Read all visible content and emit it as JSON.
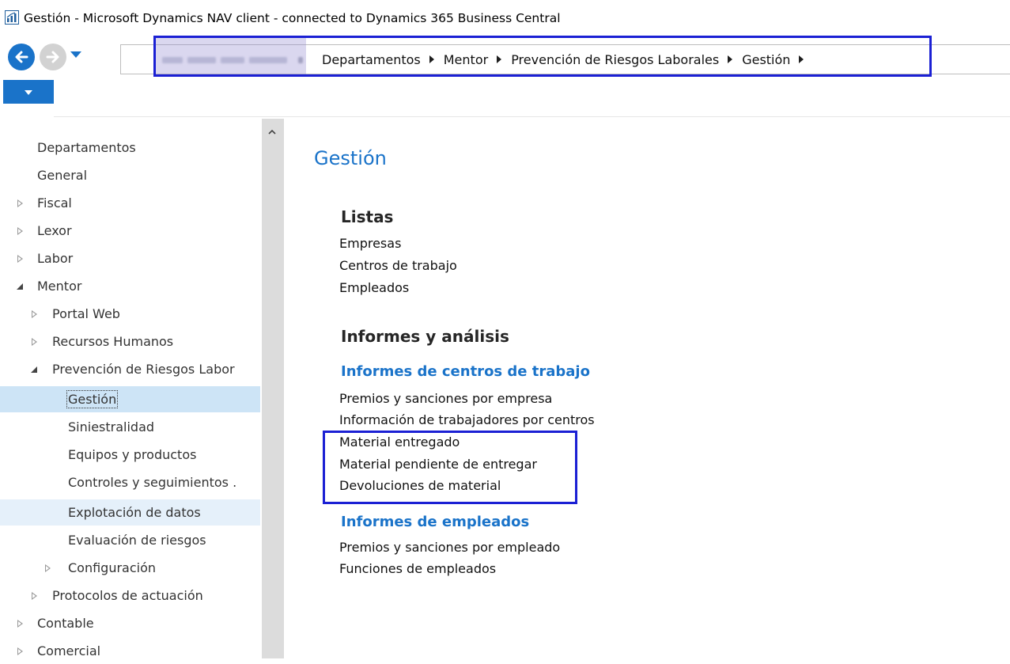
{
  "window": {
    "title": "Gestión - Microsoft Dynamics NAV client - connected to Dynamics 365 Business Central"
  },
  "nav": {
    "back_icon": "arrow-left-icon",
    "forward_icon": "arrow-right-icon",
    "history_icon": "chevron-down-icon"
  },
  "breadcrumb": {
    "items": [
      "Departamentos",
      "Mentor",
      "Prevención de Riesgos Laborales",
      "Gestión"
    ]
  },
  "sidebar": {
    "items": [
      {
        "label": "Departamentos",
        "expander": "none"
      },
      {
        "label": "General",
        "expander": "none"
      },
      {
        "label": "Fiscal",
        "expander": "collapsed"
      },
      {
        "label": "Lexor",
        "expander": "collapsed"
      },
      {
        "label": "Labor",
        "expander": "collapsed"
      },
      {
        "label": "Mentor",
        "expander": "expanded"
      },
      {
        "label": "Portal Web",
        "expander": "collapsed"
      },
      {
        "label": "Recursos Humanos",
        "expander": "collapsed"
      },
      {
        "label": "Prevención de Riesgos Labor",
        "expander": "expanded"
      },
      {
        "label": "Gestión",
        "expander": "none",
        "state": "selected"
      },
      {
        "label": "Siniestralidad",
        "expander": "none"
      },
      {
        "label": "Equipos y productos",
        "expander": "none"
      },
      {
        "label": "Controles y seguimientos .",
        "expander": "none"
      },
      {
        "label": "Explotación de datos",
        "expander": "none",
        "state": "hover"
      },
      {
        "label": "Evaluación de riesgos",
        "expander": "none"
      },
      {
        "label": "Configuración",
        "expander": "collapsed"
      },
      {
        "label": "Protocolos de actuación",
        "expander": "collapsed"
      },
      {
        "label": "Contable",
        "expander": "collapsed"
      },
      {
        "label": "Comercial",
        "expander": "collapsed"
      }
    ]
  },
  "content": {
    "page_title": "Gestión",
    "listas": {
      "heading": "Listas",
      "links": [
        "Empresas",
        "Centros de trabajo",
        "Empleados"
      ]
    },
    "informes": {
      "heading": "Informes y análisis",
      "groups": [
        {
          "title": "Informes de centros de trabajo",
          "links": [
            "Premios y sanciones por empresa",
            "Información de trabajadores por centros",
            "Material entregado",
            "Material pendiente de entregar",
            "Devoluciones de material"
          ]
        },
        {
          "title": "Informes de empleados",
          "links": [
            "Premios y sanciones por empleado",
            "Funciones de empleados"
          ]
        }
      ]
    }
  },
  "colors": {
    "accent": "#1a73c9",
    "highlight_box": "#1b20d4",
    "selected_row": "#cde4f6"
  }
}
